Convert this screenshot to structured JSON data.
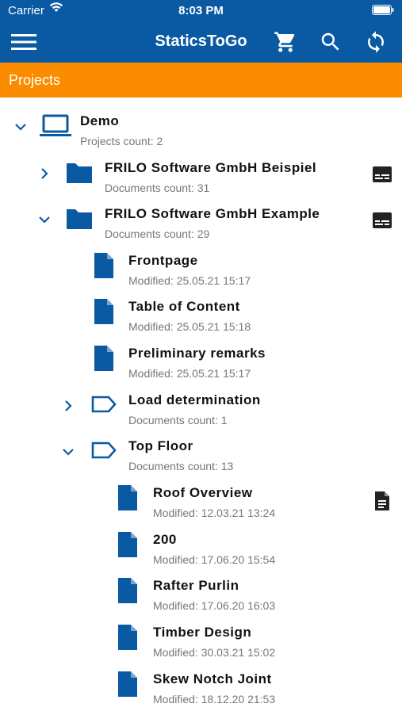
{
  "status_bar": {
    "carrier": "Carrier",
    "time": "8:03 PM"
  },
  "nav": {
    "title": "StaticsToGo",
    "icons": [
      "menu-icon",
      "cart-icon",
      "search-icon",
      "sync-icon"
    ]
  },
  "section": {
    "title": "Projects"
  },
  "colors": {
    "primary": "#0a5aa3",
    "accent": "#fb8c00",
    "icon": "#0a5aa3"
  },
  "tree": {
    "demo": {
      "name": "Demo",
      "sub": "Projects count: 2",
      "expanded": true
    },
    "beispiel": {
      "name": "FRILO Software GmbH Beispiel",
      "sub": "Documents count: 31",
      "expanded": false
    },
    "example": {
      "name": "FRILO Software GmbH Example",
      "sub": "Documents count: 29",
      "expanded": true
    },
    "frontpage": {
      "name": "Frontpage",
      "sub": "Modified: 25.05.21 15:17"
    },
    "toc": {
      "name": "Table of Content",
      "sub": "Modified: 25.05.21 15:18"
    },
    "prelim": {
      "name": "Preliminary remarks",
      "sub": "Modified: 25.05.21 15:17"
    },
    "load": {
      "name": "Load determination",
      "sub": "Documents count: 1",
      "expanded": false
    },
    "topfloor": {
      "name": "Top Floor",
      "sub": "Documents count: 13",
      "expanded": true
    },
    "roof": {
      "name": "Roof Overview",
      "sub": "Modified: 12.03.21 13:24"
    },
    "d200": {
      "name": "200",
      "sub": "Modified: 17.06.20 15:54"
    },
    "rafter": {
      "name": "Rafter Purlin",
      "sub": "Modified: 17.06.20 16:03"
    },
    "timber": {
      "name": "Timber Design",
      "sub": "Modified: 30.03.21 15:02"
    },
    "skew": {
      "name": "Skew Notch Joint",
      "sub": "Modified: 18.12.20 21:53"
    }
  }
}
